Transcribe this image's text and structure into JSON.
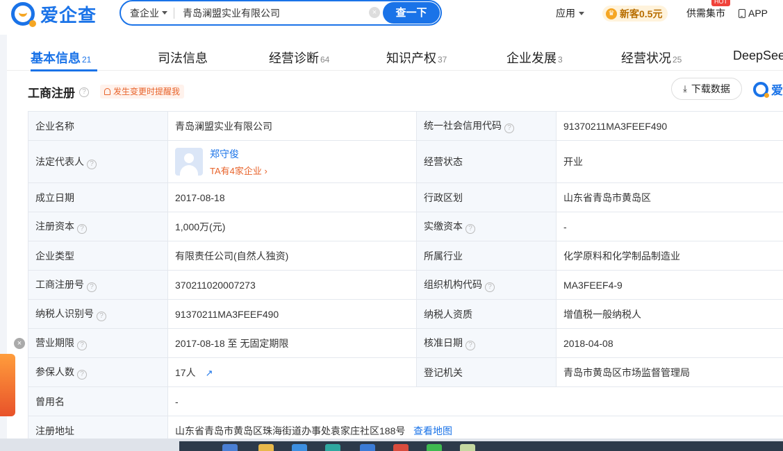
{
  "header": {
    "logo_text": "爱企查",
    "search": {
      "type_label": "查企业",
      "value": "青岛澜盟实业有限公司",
      "button_label": "查一下"
    },
    "nav": {
      "apps": "应用",
      "newbie": "新客0.5元",
      "market": "供需集市",
      "hot": "HOT",
      "app": "APP"
    }
  },
  "tabs": [
    {
      "label": "基本信息",
      "count": "21"
    },
    {
      "label": "司法信息",
      "count": ""
    },
    {
      "label": "经营诊断",
      "count": "64"
    },
    {
      "label": "知识产权",
      "count": "37"
    },
    {
      "label": "企业发展",
      "count": "3"
    },
    {
      "label": "经营状况",
      "count": "25"
    },
    {
      "label": "DeepSee",
      "count": ""
    }
  ],
  "section": {
    "title": "工商注册",
    "remind": "发生变更时提醒我",
    "download": "下载数据",
    "brand": "爱"
  },
  "info": {
    "company_name_label": "企业名称",
    "company_name": "青岛澜盟实业有限公司",
    "credit_code_label": "统一社会信用代码",
    "credit_code": "91370211MA3FEEF490",
    "legal_rep_label": "法定代表人",
    "legal_rep_name": "郑守俊",
    "legal_rep_sub": "TA有4家企业 ›",
    "status_label": "经营状态",
    "status": "开业",
    "founded_label": "成立日期",
    "founded": "2017-08-18",
    "region_label": "行政区划",
    "region": "山东省青岛市黄岛区",
    "reg_capital_label": "注册资本",
    "reg_capital": "1,000万(元)",
    "paid_capital_label": "实缴资本",
    "paid_capital": "-",
    "type_label": "企业类型",
    "type": "有限责任公司(自然人独资)",
    "industry_label": "所属行业",
    "industry": "化学原料和化学制品制造业",
    "reg_no_label": "工商注册号",
    "reg_no": "370211020007273",
    "org_code_label": "组织机构代码",
    "org_code": "MA3FEEF4-9",
    "tax_id_label": "纳税人识别号",
    "tax_id": "91370211MA3FEEF490",
    "tax_qual_label": "纳税人资质",
    "tax_qual": "增值税一般纳税人",
    "term_label": "营业期限",
    "term": "2017-08-18 至 无固定期限",
    "approve_label": "核准日期",
    "approve": "2018-04-08",
    "insured_label": "参保人数",
    "insured": "17人",
    "authority_label": "登记机关",
    "authority": "青岛市黄岛区市场监督管理局",
    "former_name_label": "曾用名",
    "former_name": "-",
    "address_label": "注册地址",
    "address": "山东省青岛市黄岛区珠海街道办事处袁家庄社区188号",
    "map_link": "查看地图"
  },
  "colors": {
    "brand": "#1a73e8",
    "accent_orange": "#e8642c",
    "label_bg": "#f5f8fc"
  }
}
